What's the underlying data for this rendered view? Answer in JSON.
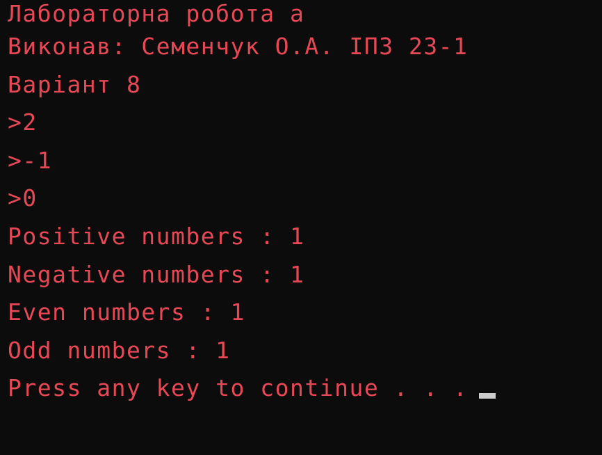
{
  "console": {
    "lines": [
      "Лабораторна робота а",
      "Виконав: Семенчук О.А. ІПЗ 23-1",
      "Варіант 8",
      ">2",
      ">-1",
      ">0",
      "Positive numbers : 1",
      "Negative numbers : 1",
      "Even numbers : 1",
      "Odd numbers : 1",
      "Press any key to continue . . ."
    ],
    "colors": {
      "background": "#0c0c0c",
      "text": "#e74856",
      "cursor": "#cccccc"
    }
  }
}
